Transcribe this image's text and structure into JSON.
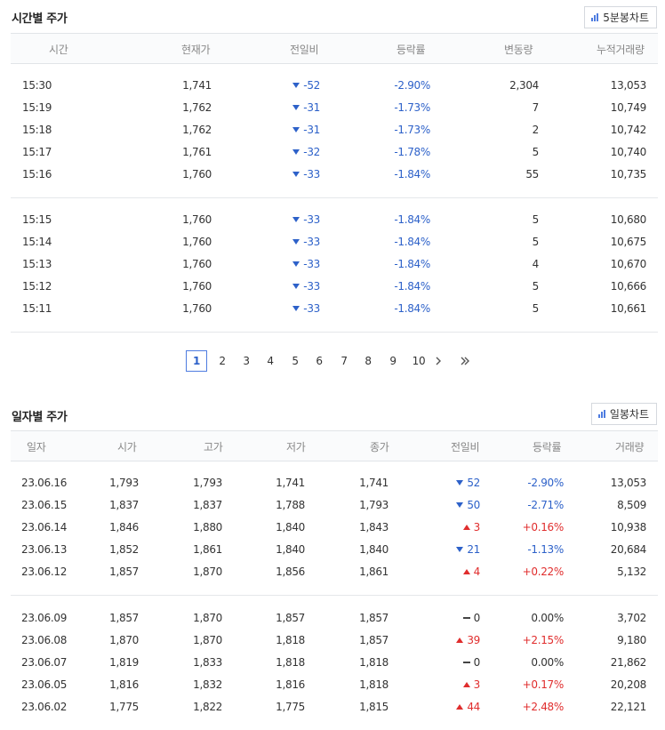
{
  "time_section": {
    "title": "시간별 주가",
    "chart_button": "5분봉차트",
    "headers": [
      "시간",
      "현재가",
      "전일비",
      "등락률",
      "변동량",
      "누적거래량"
    ],
    "groups": [
      [
        {
          "time": "15:30",
          "price": "1,741",
          "change": "-52",
          "rate": "-2.90%",
          "vol": "2,304",
          "cum": "13,053"
        },
        {
          "time": "15:19",
          "price": "1,762",
          "change": "-31",
          "rate": "-1.73%",
          "vol": "7",
          "cum": "10,749"
        },
        {
          "time": "15:18",
          "price": "1,762",
          "change": "-31",
          "rate": "-1.73%",
          "vol": "2",
          "cum": "10,742"
        },
        {
          "time": "15:17",
          "price": "1,761",
          "change": "-32",
          "rate": "-1.78%",
          "vol": "5",
          "cum": "10,740"
        },
        {
          "time": "15:16",
          "price": "1,760",
          "change": "-33",
          "rate": "-1.84%",
          "vol": "55",
          "cum": "10,735"
        }
      ],
      [
        {
          "time": "15:15",
          "price": "1,760",
          "change": "-33",
          "rate": "-1.84%",
          "vol": "5",
          "cum": "10,680"
        },
        {
          "time": "15:14",
          "price": "1,760",
          "change": "-33",
          "rate": "-1.84%",
          "vol": "5",
          "cum": "10,675"
        },
        {
          "time": "15:13",
          "price": "1,760",
          "change": "-33",
          "rate": "-1.84%",
          "vol": "4",
          "cum": "10,670"
        },
        {
          "time": "15:12",
          "price": "1,760",
          "change": "-33",
          "rate": "-1.84%",
          "vol": "5",
          "cum": "10,666"
        },
        {
          "time": "15:11",
          "price": "1,760",
          "change": "-33",
          "rate": "-1.84%",
          "vol": "5",
          "cum": "10,661"
        }
      ]
    ]
  },
  "pagination": {
    "pages": [
      "1",
      "2",
      "3",
      "4",
      "5",
      "6",
      "7",
      "8",
      "9",
      "10"
    ],
    "current": "1",
    "next_icon": "chevron-right-icon",
    "last_icon": "double-chevron-right-icon"
  },
  "daily_section": {
    "title": "일자별 주가",
    "chart_button": "일봉차트",
    "headers": [
      "일자",
      "시가",
      "고가",
      "저가",
      "종가",
      "전일비",
      "등락률",
      "거래량"
    ],
    "groups": [
      [
        {
          "date": "23.06.16",
          "open": "1,793",
          "high": "1,793",
          "low": "1,741",
          "close": "1,741",
          "dir": "down",
          "change": "52",
          "rate": "-2.90%",
          "vol": "13,053"
        },
        {
          "date": "23.06.15",
          "open": "1,837",
          "high": "1,837",
          "low": "1,788",
          "close": "1,793",
          "dir": "down",
          "change": "50",
          "rate": "-2.71%",
          "vol": "8,509"
        },
        {
          "date": "23.06.14",
          "open": "1,846",
          "high": "1,880",
          "low": "1,840",
          "close": "1,843",
          "dir": "up",
          "change": "3",
          "rate": "+0.16%",
          "vol": "10,938"
        },
        {
          "date": "23.06.13",
          "open": "1,852",
          "high": "1,861",
          "low": "1,840",
          "close": "1,840",
          "dir": "down",
          "change": "21",
          "rate": "-1.13%",
          "vol": "20,684"
        },
        {
          "date": "23.06.12",
          "open": "1,857",
          "high": "1,870",
          "low": "1,856",
          "close": "1,861",
          "dir": "up",
          "change": "4",
          "rate": "+0.22%",
          "vol": "5,132"
        }
      ],
      [
        {
          "date": "23.06.09",
          "open": "1,857",
          "high": "1,870",
          "low": "1,857",
          "close": "1,857",
          "dir": "flat",
          "change": "0",
          "rate": "0.00%",
          "vol": "3,702"
        },
        {
          "date": "23.06.08",
          "open": "1,870",
          "high": "1,870",
          "low": "1,818",
          "close": "1,857",
          "dir": "up",
          "change": "39",
          "rate": "+2.15%",
          "vol": "9,180"
        },
        {
          "date": "23.06.07",
          "open": "1,819",
          "high": "1,833",
          "low": "1,818",
          "close": "1,818",
          "dir": "flat",
          "change": "0",
          "rate": "0.00%",
          "vol": "21,862"
        },
        {
          "date": "23.06.05",
          "open": "1,816",
          "high": "1,832",
          "low": "1,816",
          "close": "1,818",
          "dir": "up",
          "change": "3",
          "rate": "+0.17%",
          "vol": "20,208"
        },
        {
          "date": "23.06.02",
          "open": "1,775",
          "high": "1,822",
          "low": "1,775",
          "close": "1,815",
          "dir": "up",
          "change": "44",
          "rate": "+2.48%",
          "vol": "22,121"
        }
      ]
    ]
  },
  "colors": {
    "down": "#2d61c9",
    "up": "#e02d2d",
    "accent": "#4e7ce0"
  }
}
